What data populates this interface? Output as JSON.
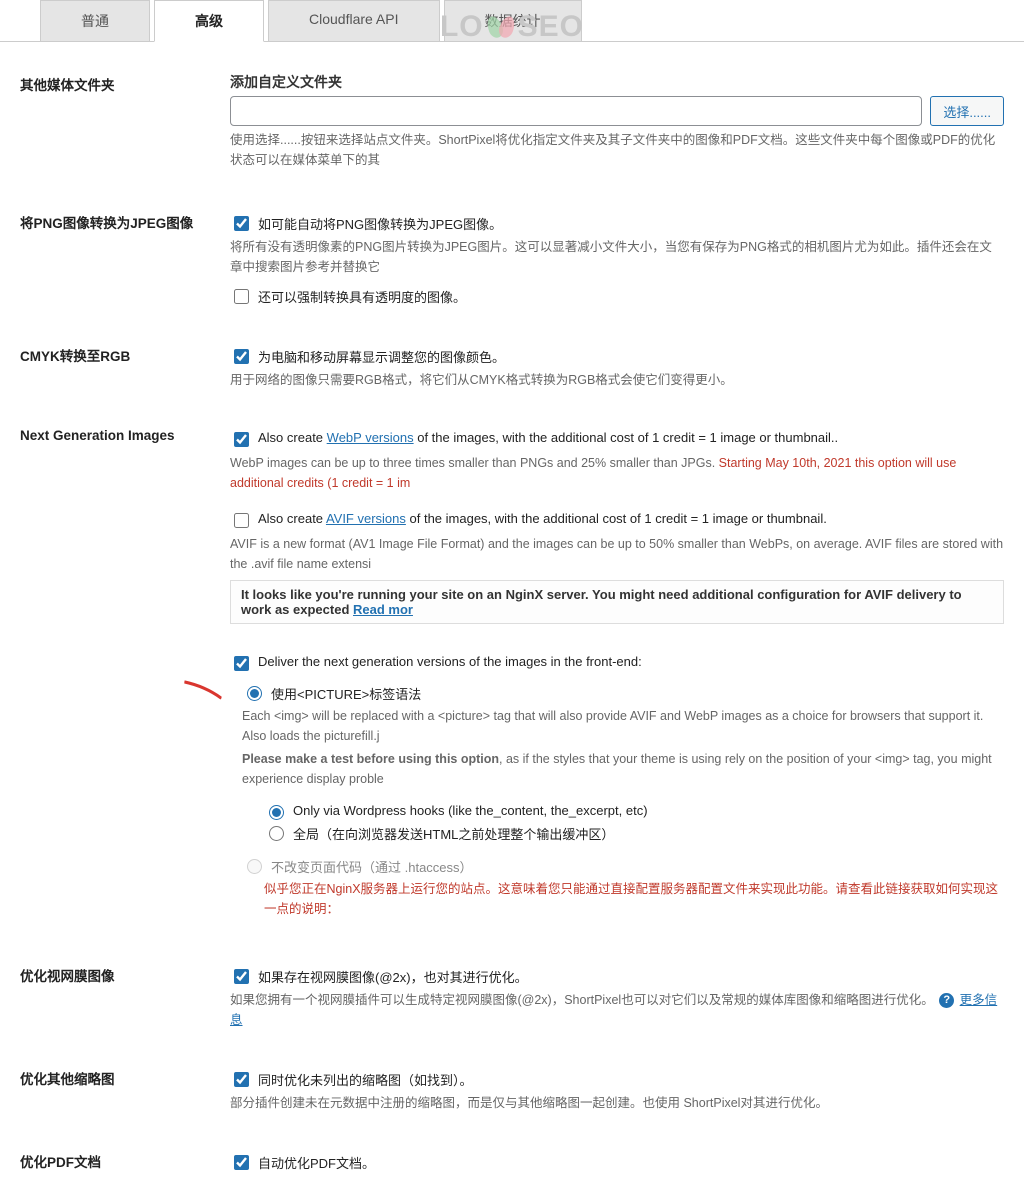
{
  "watermark": "LOYSEO",
  "tabs": {
    "normal": "普通",
    "advanced": "高级",
    "cloudflare": "Cloudflare API",
    "stats": "数据统计"
  },
  "folders": {
    "label": "其他媒体文件夹",
    "heading": "添加自定义文件夹",
    "input_value": "",
    "button": "选择......",
    "desc": "使用选择......按钮来选择站点文件夹。ShortPixel将优化指定文件夹及其子文件夹中的图像和PDF文档。这些文件夹中每个图像或PDF的优化状态可以在媒体菜单下的其"
  },
  "png2jpg": {
    "label": "将PNG图像转换为JPEG图像",
    "opt1": "如可能自动将PNG图像转换为JPEG图像。",
    "desc1": "将所有没有透明像素的PNG图片转换为JPEG图片。这可以显著减小文件大小，当您有保存为PNG格式的相机图片尤为如此。插件还会在文章中搜索图片参考并替换它",
    "opt2": "还可以强制转换具有透明度的图像。"
  },
  "cmyk": {
    "label": "CMYK转换至RGB",
    "opt": "为电脑和移动屏幕显示调整您的图像颜色。",
    "desc": "用于网络的图像只需要RGB格式，将它们从CMYK格式转换为RGB格式会使它们变得更小。"
  },
  "nextgen": {
    "label": "Next Generation Images",
    "webp_pre": "Also create ",
    "webp_link": "WebP versions",
    "webp_post": " of the images, with the additional cost of 1 credit = 1 image or thumbnail..",
    "webp_desc_a": "WebP images can be up to three times smaller than PNGs and 25% smaller than JPGs. ",
    "webp_desc_b": "Starting May 10th, 2021 this option will use additional credits (1 credit = 1 im",
    "avif_pre": "Also create ",
    "avif_link": "AVIF versions",
    "avif_post": " of the images, with the additional cost of 1 credit = 1 image or thumbnail.",
    "avif_desc": "AVIF is a new format (AV1 Image File Format) and the images can be up to 50% smaller than WebPs, on average. AVIF files are stored with the .avif file name extensi",
    "notice_a": "It looks like you're running your site on an NginX server. You might need additional configuration for AVIF delivery to work as expected ",
    "notice_link": "Read mor",
    "deliver": "Deliver the next generation versions of the images in the front-end:",
    "picture": "使用<PICTURE>标签语法",
    "picture_desc1": "Each <img> will be replaced with a <picture> tag that will also provide AVIF and WebP images as a choice for browsers that support it. Also loads the picturefill.j",
    "picture_desc2_a": "Please make a test before using this option",
    "picture_desc2_b": ", as if the styles that your theme is using rely on the position of your <img> tag, you might experience display proble",
    "sub1": "Only via Wordpress hooks (like the_content, the_excerpt, etc)",
    "sub2": "全局（在向浏览器发送HTML之前处理整个输出缓冲区）",
    "sub3": "不改变页面代码（通过 .htaccess）",
    "sub3_warn": "似乎您正在NginX服务器上运行您的站点。这意味着您只能通过直接配置服务器配置文件来实现此功能。请查看此链接获取如何实现这一点的说明："
  },
  "retina": {
    "label": "优化视网膜图像",
    "opt": "如果存在视网膜图像(@2x)，也对其进行优化。",
    "desc_a": "如果您拥有一个视网膜插件可以生成特定视网膜图像(@2x)，ShortPixel也可以对它们以及常规的媒体库图像和缩略图进行优化。",
    "more": "更多信息"
  },
  "otherthumbs": {
    "label": "优化其他缩略图",
    "opt": "同时优化未列出的缩略图（如找到）。",
    "desc": "部分插件创建未在元数据中注册的缩略图，而是仅与其他缩略图一起创建。也使用 ShortPixel对其进行优化。"
  },
  "pdf": {
    "label": "优化PDF文档",
    "opt": "自动优化PDF文档。"
  }
}
